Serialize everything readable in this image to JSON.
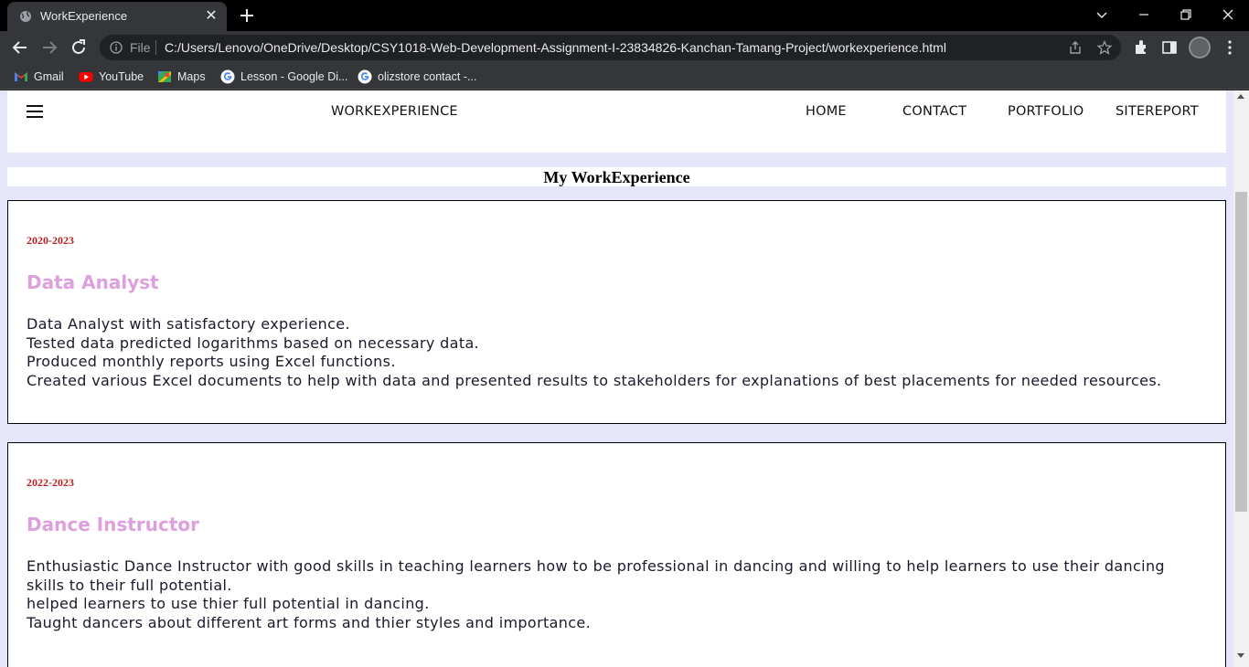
{
  "browser": {
    "tab_title": "WorkExperience",
    "omnibox_scheme": "File",
    "url": "C:/Users/Lenovo/OneDrive/Desktop/CSY1018-Web-Development-Assignment-I-23834826-Kanchan-Tamang-Project/workexperience.html",
    "bookmarks": [
      {
        "label": "Gmail",
        "icon": "gmail-icon"
      },
      {
        "label": "YouTube",
        "icon": "youtube-icon"
      },
      {
        "label": "Maps",
        "icon": "maps-icon"
      },
      {
        "label": "Lesson - Google Di...",
        "icon": "google-icon"
      },
      {
        "label": "olizstore contact -...",
        "icon": "google-icon"
      }
    ]
  },
  "site": {
    "page_name": "WORKEXPERIENCE",
    "nav": [
      "HOME",
      "CONTACT",
      "PORTFOLIO",
      "SITEREPORT"
    ],
    "section_title": "My WorkExperience"
  },
  "experience": [
    {
      "years": "2020-2023",
      "title": "Data Analyst",
      "lines": [
        "Data Analyst with satisfactory experience.",
        "Tested data predicted logarithms based on necessary data.",
        "Produced monthly reports using Excel functions.",
        "Created various Excel documents to help with data and presented results to stakeholders for explanations of best placements for needed resources."
      ]
    },
    {
      "years": "2022-2023",
      "title": "Dance Instructor",
      "lines": [
        "Enthusiastic Dance Instructor with good skills in teaching learners how to be professional in dancing and willing to help learners to use their dancing skills to their full potential.",
        "helped learners to use thier full potential in dancing.",
        "Taught dancers about different art forms and thier styles and importance."
      ]
    }
  ],
  "colors": {
    "page_bg": "#e6e6fa",
    "years": "#b22222",
    "job_title": "#dda0dd",
    "chrome_dark": "#000000",
    "chrome_toolbar": "#35363a"
  }
}
